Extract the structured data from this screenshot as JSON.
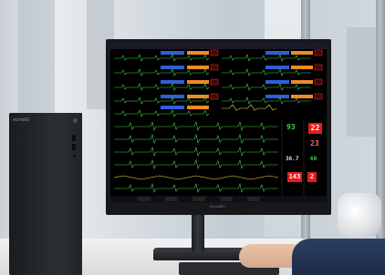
{
  "tower": {
    "brand": "HUAWEI"
  },
  "monitor": {
    "brand": "HUAWEI"
  },
  "screen": {
    "top_bar_text": "",
    "rows": [
      {
        "label": "",
        "value": ""
      },
      {
        "label": "",
        "value": ""
      },
      {
        "label": "",
        "value": ""
      },
      {
        "label": "",
        "value": ""
      },
      {
        "label": "",
        "value": ""
      }
    ],
    "side_values": {
      "v1": "93",
      "v2": "22",
      "v3": "23",
      "v4": "36.7",
      "v5": "60",
      "v6": "143",
      "v7": "2"
    }
  },
  "colors": {
    "waveform_green": "#3fd14a",
    "waveform_yellow": "#e8e23a",
    "header_blue": "#2f5fd8",
    "header_orange": "#f08a24",
    "alarm_red": "#e81b1b"
  }
}
